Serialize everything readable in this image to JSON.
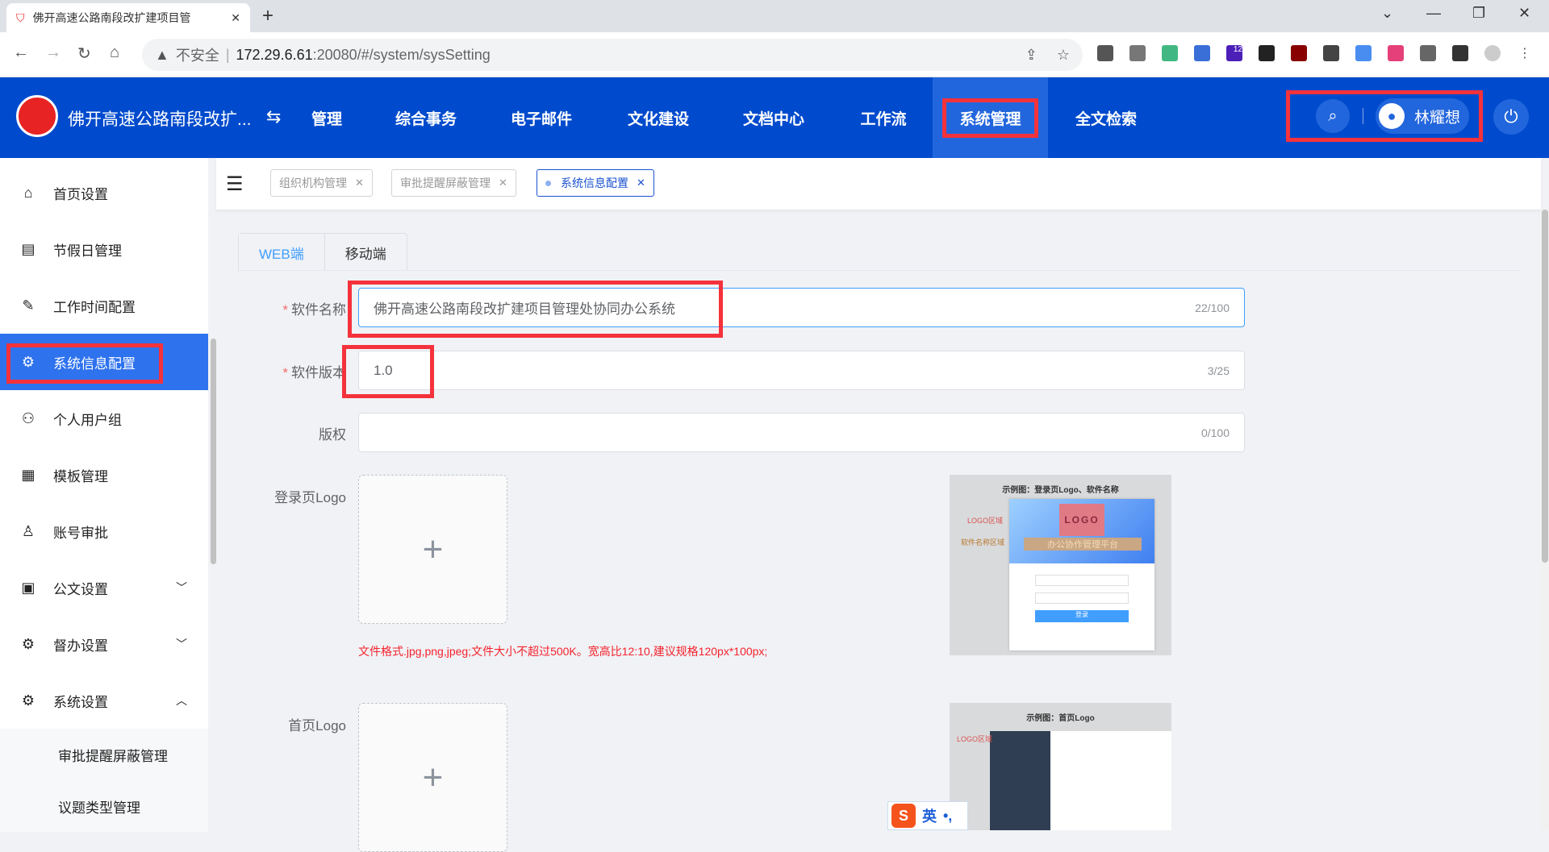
{
  "browser": {
    "tab_title": "佛开高速公路南段改扩建项目管",
    "new_tab": "+",
    "insecure_label": "不安全",
    "url_host": "172.29.6.61",
    "url_path": ":20080/#/system/sysSetting",
    "ext_badge": "12"
  },
  "header": {
    "app_name": "佛开高速公路南段改扩...",
    "nav": [
      "管理",
      "综合事务",
      "电子邮件",
      "文化建设",
      "文档中心",
      "工作流",
      "系统管理",
      "全文检索"
    ],
    "active_nav": "系统管理",
    "user_name": "林耀想",
    "colors": {
      "header_bg": "#004bcd",
      "active_nav_bg": "#2266dd",
      "highlight": "#f5323b"
    }
  },
  "sidebar": {
    "items": [
      {
        "label": "首页设置",
        "icon": "home-icon"
      },
      {
        "label": "节假日管理",
        "icon": "document-icon"
      },
      {
        "label": "工作时间配置",
        "icon": "edit-icon"
      },
      {
        "label": "系统信息配置",
        "icon": "gear-icon",
        "active": true
      },
      {
        "label": "个人用户组",
        "icon": "users-icon"
      },
      {
        "label": "模板管理",
        "icon": "template-icon"
      },
      {
        "label": "账号审批",
        "icon": "user-icon"
      },
      {
        "label": "公文设置",
        "icon": "doc-settings-icon",
        "expand": "down"
      },
      {
        "label": "督办设置",
        "icon": "gear-icon",
        "expand": "down"
      },
      {
        "label": "系统设置",
        "icon": "gear-icon",
        "expand": "up"
      }
    ],
    "subitems": [
      "审批提醒屏蔽管理",
      "议题类型管理"
    ]
  },
  "tags": [
    {
      "label": "组织机构管理"
    },
    {
      "label": "审批提醒屏蔽管理"
    },
    {
      "label": "系统信息配置",
      "active": true
    }
  ],
  "form": {
    "tabs": [
      "WEB端",
      "移动端"
    ],
    "active_tab": "WEB端",
    "software_name": {
      "label": "软件名称",
      "value": "佛开高速公路南段改扩建项目管理处协同办公系统",
      "count": "22/100"
    },
    "software_version": {
      "label": "软件版本",
      "value": "1.0",
      "count": "3/25"
    },
    "copyright": {
      "label": "版权",
      "value": "",
      "count": "0/100"
    },
    "login_logo": {
      "label": "登录页Logo",
      "hint": "文件格式.jpg,png,jpeg;文件大小不超过500K。宽高比12:10,建议规格120px*100px;"
    },
    "home_logo": {
      "label": "首页Logo"
    },
    "preview1": {
      "caption": "示例图：登录页Logo、软件名称",
      "logo_area": "LOGO区域",
      "name_area": "软件名称区域",
      "logo": "LOGO",
      "platform": "办公协作管理平台",
      "login_btn": "登录"
    },
    "preview2": {
      "caption": "示例图：首页Logo",
      "logo_area": "LOGO区域"
    }
  },
  "ime": {
    "mode": "英",
    "punct": "•,"
  }
}
